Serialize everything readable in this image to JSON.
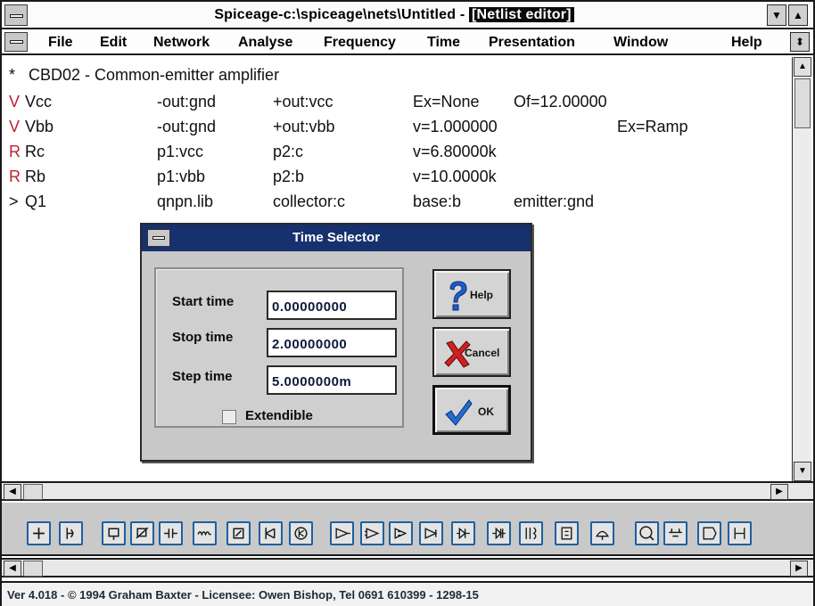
{
  "window": {
    "title_plain": "Spiceage-c:\\spiceage\\nets\\Untitled - ",
    "title_inverted": "[Netlist editor]",
    "minimize_glyph": "▼",
    "maximize_glyph": "▲",
    "menu_restore_glyph": "⬍"
  },
  "menu": [
    {
      "label": "File"
    },
    {
      "label": "Edit"
    },
    {
      "label": "Network"
    },
    {
      "label": "Analyse"
    },
    {
      "label": "Frequency"
    },
    {
      "label": "Time"
    },
    {
      "label": "Presentation"
    },
    {
      "label": "Window"
    },
    {
      "label": "Help"
    }
  ],
  "netlist": [
    {
      "lead": "*",
      "name": "CBD02 - Common-emitter amplifier",
      "c1": "",
      "c2": "",
      "c3": "",
      "c4": ""
    },
    {
      "lead": "V",
      "name": "Vcc",
      "c1": "-out:gnd",
      "c2": "+out:vcc",
      "c3": "Ex=None",
      "c4": "Of=12.00000"
    },
    {
      "lead": "V",
      "name": "Vbb",
      "c1": "-out:gnd",
      "c2": "+out:vbb",
      "c3": "v=1.000000",
      "c4": "Ex=Ramp"
    },
    {
      "lead": "R",
      "name": "Rc",
      "c1": "p1:vcc",
      "c2": "p2:c",
      "c3": "v=6.80000k",
      "c4": ""
    },
    {
      "lead": "R",
      "name": "Rb",
      "c1": "p1:vbb",
      "c2": "p2:b",
      "c3": "v=10.0000k",
      "c4": ""
    },
    {
      "lead": ">",
      "name": "Q1",
      "c1": "qnpn.lib",
      "c2": "collector:c",
      "c3": "base:b",
      "c4": "emitter:gnd"
    }
  ],
  "dialog": {
    "title": "Time Selector",
    "fields": [
      {
        "label": "Start time",
        "value": "0.00000000"
      },
      {
        "label": "Stop time",
        "value": "2.00000000"
      },
      {
        "label": "Step time",
        "value": "5.0000000m"
      }
    ],
    "checkbox_label": "Extendible",
    "checkbox_checked": false,
    "buttons": {
      "help": "Help",
      "cancel": "Cancel",
      "ok": "OK"
    }
  },
  "toolbar": {
    "icons": [
      "voltage-source-icon",
      "current-source-icon",
      "resistor-icon",
      "variable-resistor-icon",
      "capacitor-icon",
      "inductor-icon",
      "diode-icon",
      "zener-icon",
      "transistor-icon",
      "opamp-a-icon",
      "opamp-b-icon",
      "opamp-c-icon",
      "opamp-d-icon",
      "diode-pair-icon",
      "diode-bridge-icon",
      "transformer-icon",
      "ic-chip-icon",
      "lamp-icon",
      "probe-icon",
      "ground-icon",
      "label-icon",
      "more-icon"
    ]
  },
  "status": {
    "text": "Ver 4.018 - © 1994 Graham Baxter - Licensee: Owen Bishop, Tel 0691 610399 - 1298-15"
  },
  "colors": {
    "dialog_title_bg": "#17306e",
    "toolbar_icon_border": "#1f5fa0",
    "help_icon": "#1e5fd0",
    "cancel_icon": "#d02020",
    "ok_icon": "#1e6fd0"
  }
}
